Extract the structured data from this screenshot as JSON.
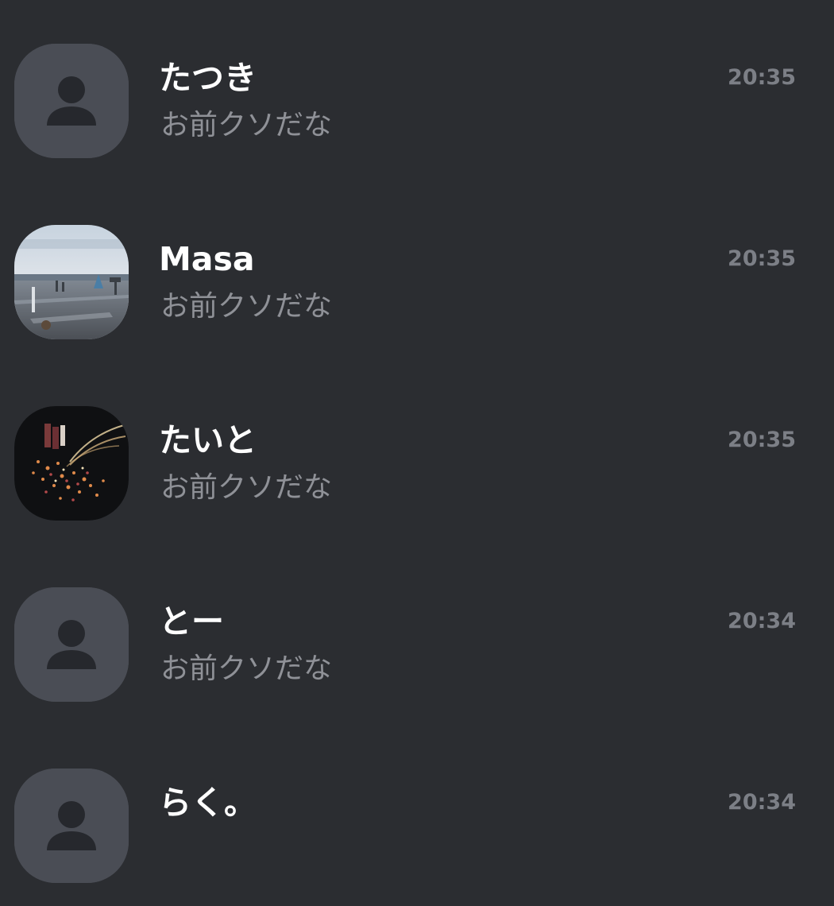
{
  "chats": [
    {
      "name": "たつき",
      "preview": "お前クソだな",
      "time": "20:35",
      "avatar": "default-person-icon"
    },
    {
      "name": "Masa",
      "preview": "お前クソだな",
      "time": "20:35",
      "avatar": "seaside-photo"
    },
    {
      "name": "たいと",
      "preview": "お前クソだな",
      "time": "20:35",
      "avatar": "fireworks-photo"
    },
    {
      "name": "とー",
      "preview": "お前クソだな",
      "time": "20:34",
      "avatar": "default-person-icon"
    },
    {
      "name": "らく。",
      "preview": "",
      "time": "20:34",
      "avatar": "default-person-icon"
    }
  ],
  "colors": {
    "background": "#2b2d31",
    "name": "#ffffff",
    "preview": "#8f9197",
    "time": "#7c7f86",
    "avatar_placeholder": "#4a4d55",
    "avatar_glyph": "#26282d"
  }
}
